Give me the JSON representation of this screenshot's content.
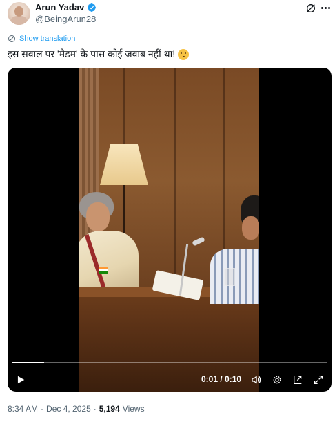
{
  "author": {
    "name": "Arun Yadav",
    "handle": "@BeingArun28",
    "verified": true
  },
  "translate_label": "Show translation",
  "tweet_text": "इस सवाल पर 'मैडम' के पास कोई जवाब नहीं था!",
  "video": {
    "progress": 0.1,
    "time_display": "0:01 / 0:10"
  },
  "footer": {
    "time": "8:34 AM",
    "separator": "·",
    "date": "Dec 4, 2025",
    "views_count": "5,194",
    "views_label": "Views"
  },
  "colors": {
    "text_primary": "#0f1419",
    "text_secondary": "#536471",
    "accent": "#1d9bf0"
  },
  "icons": {
    "verified": "verified-badge-icon",
    "grok": "grok-icon",
    "more": "more-icon",
    "translate": "globe-icon",
    "play": "play-icon",
    "volume": "volume-icon",
    "settings": "settings-icon",
    "pip": "picture-in-picture-icon",
    "fullscreen": "fullscreen-icon"
  }
}
